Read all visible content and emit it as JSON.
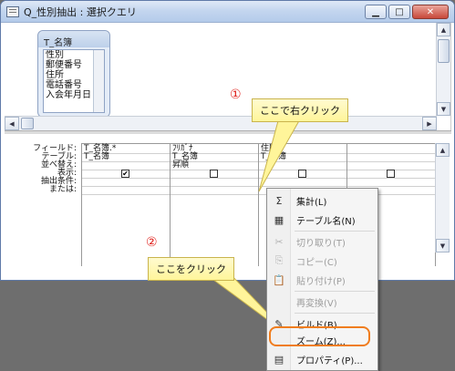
{
  "window": {
    "title": "Q_性別抽出 : 選択クエリ",
    "minimize_label": "▁",
    "maximize_label": "□",
    "close_label": "✕"
  },
  "field_table": {
    "name": "T_名簿",
    "fields": [
      "性別",
      "郵便番号",
      "住所",
      "電話番号",
      "入会年月日"
    ]
  },
  "grid": {
    "row_labels": [
      "フィールド:",
      "テーブル:",
      "並べ替え:",
      "表示:",
      "抽出条件:",
      "または:"
    ],
    "columns": [
      {
        "field": "T_名簿.*",
        "table": "T_名簿",
        "sort": "",
        "show": true
      },
      {
        "field": "ﾌﾘｶﾞﾅ",
        "table": "T_名簿",
        "sort": "昇順",
        "show": false
      },
      {
        "field": "住所",
        "table": "T_名簿",
        "sort": "",
        "show": false
      },
      {
        "field": "",
        "table": "",
        "sort": "",
        "show": false
      }
    ],
    "check_glyph": "✔"
  },
  "annotations": {
    "num1": "①",
    "num2": "②",
    "callout1": "ここで右クリック",
    "callout2": "ここをクリック"
  },
  "context_menu": {
    "items": [
      {
        "icon": "Σ",
        "label": "集計(L)",
        "enabled": true
      },
      {
        "icon": "▦",
        "label": "テーブル名(N)",
        "enabled": true
      },
      {
        "icon": "✂",
        "label": "切り取り(T)",
        "enabled": false
      },
      {
        "icon": "⎘",
        "label": "コピー(C)",
        "enabled": false
      },
      {
        "icon": "📋",
        "label": "貼り付け(P)",
        "enabled": false
      },
      {
        "icon": "",
        "label": "再変換(V)",
        "enabled": false
      },
      {
        "icon": "✎",
        "label": "ビルド(B)...",
        "enabled": true
      },
      {
        "icon": "",
        "label": "ズーム(Z)...",
        "enabled": true
      },
      {
        "icon": "▤",
        "label": "プロパティ(P)...",
        "enabled": true
      }
    ]
  },
  "colors": {
    "annotation_red": "#e0201b",
    "highlight_orange": "#f07d1e",
    "callout_yellow": "#fff59a"
  }
}
